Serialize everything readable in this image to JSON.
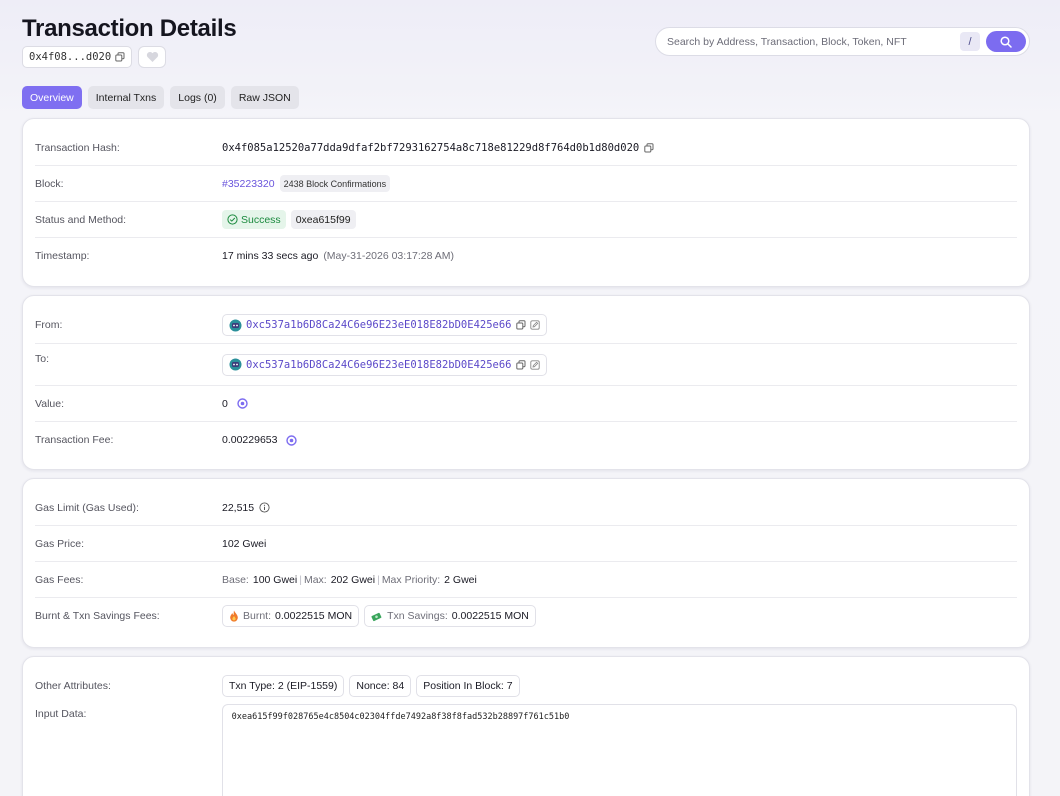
{
  "header": {
    "title": "Transaction Details",
    "short_hash": "0x4f08...d020"
  },
  "search": {
    "placeholder": "Search by Address, Transaction, Block, Token, NFT",
    "shortcut": "/"
  },
  "tabs": [
    {
      "label": "Overview",
      "active": true
    },
    {
      "label": "Internal Txns",
      "active": false
    },
    {
      "label": "Logs (0)",
      "active": false
    },
    {
      "label": "Raw JSON",
      "active": false
    }
  ],
  "overview": {
    "hash_label": "Transaction Hash:",
    "hash": "0x4f085a12520a77dda9dfaf2bf7293162754a8c718e81229d8f764d0b1d80d020",
    "block_label": "Block:",
    "block": "#35223320",
    "confirmations": "2438 Block Confirmations",
    "status_label": "Status and Method:",
    "status": "Success",
    "method": "0xea615f99",
    "timestamp_label": "Timestamp:",
    "timestamp_ago": "17 mins 33 secs ago",
    "timestamp_full": "(May-31-2026 03:17:28 AM)"
  },
  "transfer": {
    "from_label": "From:",
    "from": "0xc537a1b6D8Ca24C6e96E23eE018E82bD0E425e66",
    "to_label": "To:",
    "to": "0xc537a1b6D8Ca24C6e96E23eE018E82bD0E425e66",
    "value_label": "Value:",
    "value": "0",
    "fee_label": "Transaction Fee:",
    "fee": "0.00229653"
  },
  "gas": {
    "limit_label": "Gas Limit (Gas Used):",
    "limit": "22,515",
    "price_label": "Gas Price:",
    "price": "102 Gwei",
    "fees_label": "Gas Fees:",
    "base_label": "Base:",
    "base": "100 Gwei",
    "max_label": "Max:",
    "max": "202 Gwei",
    "priority_label": "Max Priority:",
    "priority": "2 Gwei",
    "burnt_label": "Burnt & Txn Savings Fees:",
    "burnt_key": "Burnt:",
    "burnt": "0.0022515 MON",
    "savings_key": "Txn Savings:",
    "savings": "0.0022515 MON"
  },
  "other": {
    "attributes_label": "Other Attributes:",
    "txn_type": "Txn Type: 2 (EIP-1559)",
    "nonce": "Nonce: 84",
    "position": "Position In Block: 7",
    "input_label": "Input Data:",
    "input_data": "0xea615f99f028765e4c8504c02304ffde7492a8f38f8fad532b28897f761c51b0"
  },
  "colors": {
    "accent": "#7f6ff1",
    "link": "#6a55dc",
    "success": "#1b8a3e"
  },
  "icons": [
    "copy-icon",
    "heart-icon",
    "search-icon",
    "check-circle-icon",
    "avatar-icon",
    "edit-icon",
    "coin-icon",
    "info-icon",
    "flame-icon",
    "money-icon"
  ]
}
